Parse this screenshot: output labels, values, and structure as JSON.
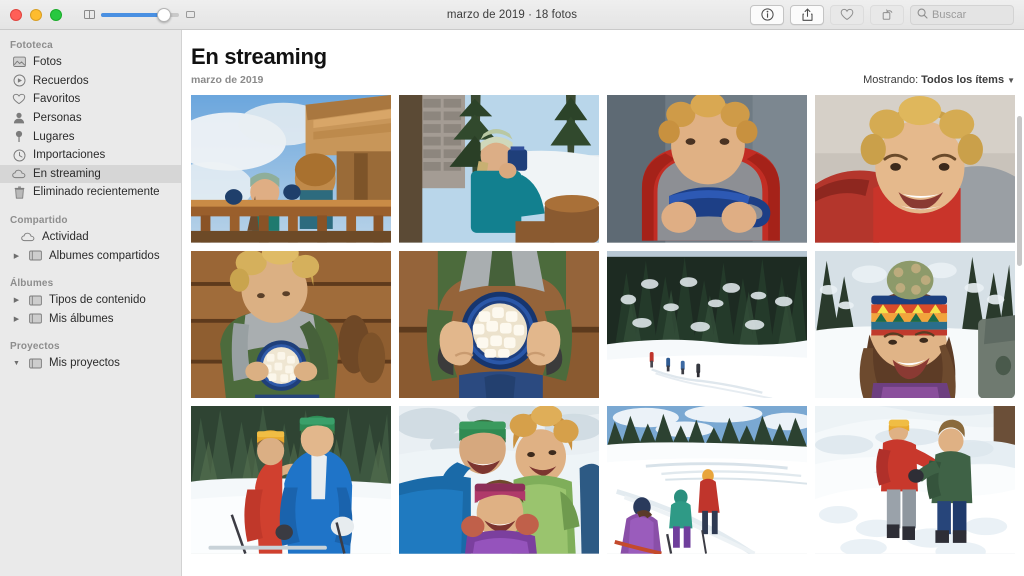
{
  "window": {
    "title": "marzo de 2019 · 18 fotos",
    "traffic_lights": [
      "close",
      "minimize",
      "zoom"
    ]
  },
  "toolbar": {
    "zoom_slider": {
      "min_icon": "small-grid-icon",
      "max_icon": "large-grid-icon",
      "value": 72
    },
    "buttons": [
      {
        "name": "info-button",
        "icon": "info-circle-icon",
        "label": ""
      },
      {
        "name": "share-button",
        "icon": "share-icon",
        "label": ""
      },
      {
        "name": "favorite-button",
        "icon": "heart-icon",
        "label": ""
      },
      {
        "name": "rotate-button",
        "icon": "rotate-icon",
        "label": ""
      }
    ],
    "search": {
      "placeholder": "Buscar",
      "value": "",
      "icon": "search-icon"
    }
  },
  "sidebar": {
    "sections": [
      {
        "header": "Fototeca",
        "items": [
          {
            "label": "Fotos",
            "icon": "photos-icon",
            "selected": false,
            "disclosure": null
          },
          {
            "label": "Recuerdos",
            "icon": "memories-icon",
            "selected": false,
            "disclosure": null
          },
          {
            "label": "Favoritos",
            "icon": "heart-icon",
            "selected": false,
            "disclosure": null
          },
          {
            "label": "Personas",
            "icon": "person-icon",
            "selected": false,
            "disclosure": null
          },
          {
            "label": "Lugares",
            "icon": "pin-icon",
            "selected": false,
            "disclosure": null
          },
          {
            "label": "Importaciones",
            "icon": "clock-icon",
            "selected": false,
            "disclosure": null
          },
          {
            "label": "En streaming",
            "icon": "cloud-icon",
            "selected": true,
            "disclosure": null
          },
          {
            "label": "Eliminado recientemente",
            "icon": "trash-icon",
            "selected": false,
            "disclosure": null
          }
        ]
      },
      {
        "header": "Compartido",
        "items": [
          {
            "label": "Actividad",
            "icon": "cloud-icon",
            "selected": false,
            "disclosure": null
          },
          {
            "label": "Álbumes compartidos",
            "icon": "album-icon",
            "selected": false,
            "disclosure": "collapsed"
          }
        ]
      },
      {
        "header": "Álbumes",
        "items": [
          {
            "label": "Tipos de contenido",
            "icon": "album-icon",
            "selected": false,
            "disclosure": "collapsed"
          },
          {
            "label": "Mis álbumes",
            "icon": "album-icon",
            "selected": false,
            "disclosure": "collapsed"
          }
        ]
      },
      {
        "header": "Proyectos",
        "items": [
          {
            "label": "Mis proyectos",
            "icon": "album-icon",
            "selected": false,
            "disclosure": "expanded"
          }
        ]
      }
    ]
  },
  "main": {
    "title": "En streaming",
    "subtitle": "marzo de 2019",
    "filter": {
      "prefix": "Mostrando:",
      "value": "Todos los ítems",
      "chevron": "chevron-down-icon"
    },
    "photos": [
      {
        "alt": "Dos niños con tazas en un balcón de cabaña de madera con cielo nublado"
      },
      {
        "alt": "Mujer con gorro bebiendo de una taza azul junto a chimenea de piedra"
      },
      {
        "alt": "Niño de pelo rizado bebiendo de una taza azul esmaltada"
      },
      {
        "alt": "Retrato de niño sonriente de pelo rizado con chaqueta roja"
      },
      {
        "alt": "Niño sentado sosteniendo un tazón de chocolate con malvaviscos"
      },
      {
        "alt": "Primer plano de manos sosteniendo un tazón azul con malvaviscos"
      },
      {
        "alt": "Cuatro excursionistas con raquetas de nieve frente a un bosque nevado"
      },
      {
        "alt": "Niña riendo con gorro de pompón colorido en la nieve"
      },
      {
        "alt": "Pareja con chaquetas roja y azul esquiando en la nieve"
      },
      {
        "alt": "Familia tumbada en la nieve con chaquetas de colores"
      },
      {
        "alt": "Grupo caminando con raquetas de nieve en campo nevado"
      },
      {
        "alt": "Dos personas jugando en un montículo de nieve"
      }
    ]
  },
  "colors": {
    "accent": "#4a90e2",
    "sidebar_bg": "#eaeaea",
    "selected_bg": "#d6d6d6",
    "toolbar_bg": "#ececec",
    "content_bg": "#ffffff",
    "title_text": "#111111",
    "muted_text": "#8a8a8a"
  }
}
